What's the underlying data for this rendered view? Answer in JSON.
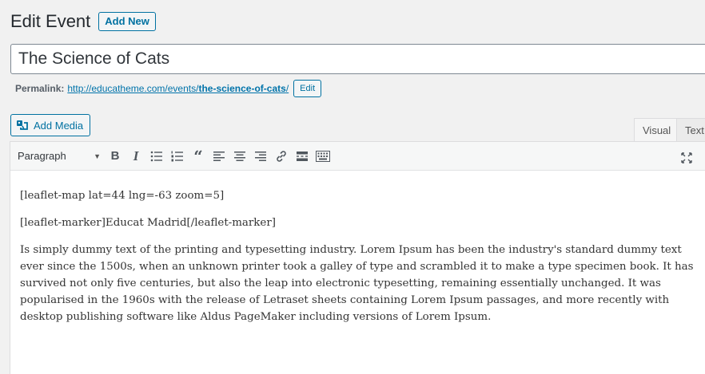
{
  "header": {
    "title": "Edit Event",
    "add_new_label": "Add New"
  },
  "post_title": {
    "value": "The Science of Cats"
  },
  "permalink": {
    "label": "Permalink:",
    "url_prefix": "http://educatheme.com/events/",
    "slug": "the-science-of-cats",
    "url_suffix": "/",
    "edit_label": "Edit"
  },
  "media": {
    "add_media_label": "Add Media"
  },
  "editor_tabs": {
    "visual": "Visual",
    "text": "Text"
  },
  "toolbar": {
    "format": "Paragraph",
    "buttons": [
      "bold-icon",
      "italic-icon",
      "bulleted-list-icon",
      "numbered-list-icon",
      "blockquote-icon",
      "align-left-icon",
      "align-center-icon",
      "align-right-icon",
      "link-icon",
      "read-more-icon",
      "toolbar-toggle-icon"
    ],
    "expand": "fullscreen-icon"
  },
  "content": {
    "paragraphs": [
      "[leaflet-map lat=44 lng=-63 zoom=5]",
      "[leaflet-marker]Educat Madrid[/leaflet-marker]",
      "Is simply dummy text of the printing and typesetting industry. Lorem Ipsum has been the industry's standard dummy text ever since the 1500s, when an unknown printer took a galley of type and scrambled it to make a type specimen book. It has survived not only five centuries, but also the leap into electronic typesetting, remaining essentially unchanged. It was popularised in the 1960s with the release of Letraset sheets containing Lorem Ipsum passages, and more recently with desktop publishing software like Aldus PageMaker including versions of Lorem Ipsum."
    ]
  },
  "colors": {
    "link": "#0073aa",
    "button_border": "#0071a1",
    "background": "#f1f1f1"
  }
}
